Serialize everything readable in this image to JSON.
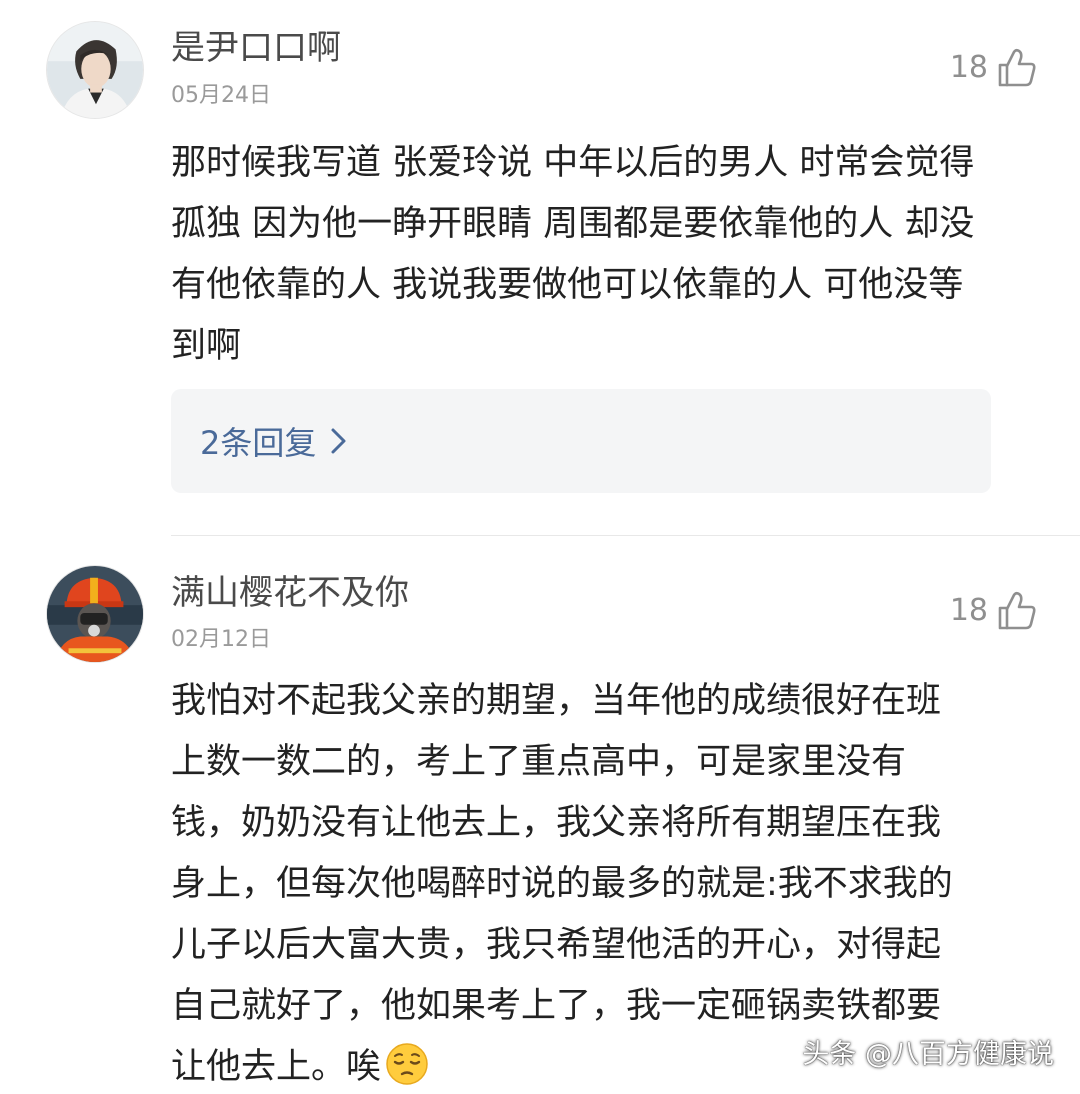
{
  "comments": [
    {
      "username": "是尹口口啊",
      "date": "05月24日",
      "likes": "18",
      "body_lines": [
        "那时候我写道 张爱玲说 中年以后的男人 时常会觉得",
        "孤独 因为他一睁开眼睛 周围都是要依靠他的人 却没",
        "有他依靠的人 我说我要做他可以依靠的人 可他没等",
        "到啊"
      ],
      "replies_label": "2条回复"
    },
    {
      "username": "满山樱花不及你",
      "date": "02月12日",
      "likes": "18",
      "body_lines": [
        "我怕对不起我父亲的期望，当年他的成绩很好在班",
        "上数一数二的，考上了重点高中，可是家里没有",
        "钱，奶奶没有让他去上，我父亲将所有期望压在我",
        "身上，但每次他喝醉时说的最多的就是:我不求我的",
        "儿子以后大富大贵，我只希望他活的开心，对得起",
        "自己就好了，他如果考上了，我一定砸锅卖铁都要",
        "让他去上。唉"
      ],
      "trailing_emoji": "pensive-face-emoji"
    }
  ],
  "watermark": "头条 @八百方健康说",
  "icons": {
    "like": "thumbs-up-icon",
    "replies_arrow": "chevron-right-icon"
  },
  "colors": {
    "link": "#4a6a99",
    "secondary_text": "#9a9a9a",
    "reply_box_bg": "#f4f5f6"
  }
}
